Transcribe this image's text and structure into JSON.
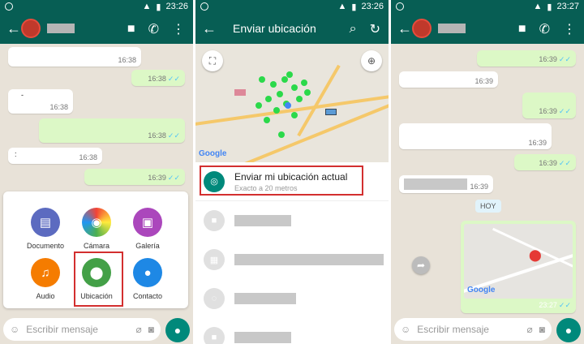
{
  "status": {
    "time_1": "23:26",
    "time_2": "23:26",
    "time_3": "23:27"
  },
  "panel1": {
    "messages": [
      {
        "side": "in",
        "time": "16:38"
      },
      {
        "side": "out",
        "time": "16:38"
      },
      {
        "side": "in",
        "text": "-",
        "time": "16:38"
      },
      {
        "side": "out",
        "time": "16:38"
      },
      {
        "side": "in",
        "text": ":",
        "time": "16:38"
      },
      {
        "side": "out",
        "time": "16:39"
      }
    ],
    "attach": [
      {
        "label": "Documento",
        "color": "#5c6bc0",
        "icon": "document-icon",
        "glyph": "▤"
      },
      {
        "label": "Cámara",
        "color": "#e91e63",
        "icon": "camera-icon",
        "glyph": "◉"
      },
      {
        "label": "Galería",
        "color": "#ab47bc",
        "icon": "gallery-icon",
        "glyph": "▣"
      },
      {
        "label": "Audio",
        "color": "#f57c00",
        "icon": "headphones-icon",
        "glyph": "♫"
      },
      {
        "label": "Ubicación",
        "color": "#43a047",
        "icon": "location-icon",
        "glyph": "⬤"
      },
      {
        "label": "Contacto",
        "color": "#1e88e5",
        "icon": "contact-icon",
        "glyph": "●"
      }
    ],
    "input_placeholder": "Escribir mensaje"
  },
  "panel2": {
    "title": "Enviar ubicación",
    "send_current": "Enviar mi ubicación actual",
    "accuracy": "Exacto a 20 metros"
  },
  "panel3": {
    "messages": [
      {
        "side": "out",
        "time": "16:39"
      },
      {
        "side": "in",
        "time": "16:39"
      },
      {
        "side": "out",
        "time": "16:39"
      },
      {
        "side": "in",
        "time": "16:39"
      },
      {
        "side": "out",
        "time": "16:39"
      },
      {
        "side": "in",
        "time": "16:39"
      }
    ],
    "day_label": "HOY",
    "map_time": "23:27",
    "input_placeholder": "Escribir mensaje"
  },
  "colors": {
    "header": "#075e54",
    "accent": "#00897b",
    "highlight": "#d32f2f"
  }
}
